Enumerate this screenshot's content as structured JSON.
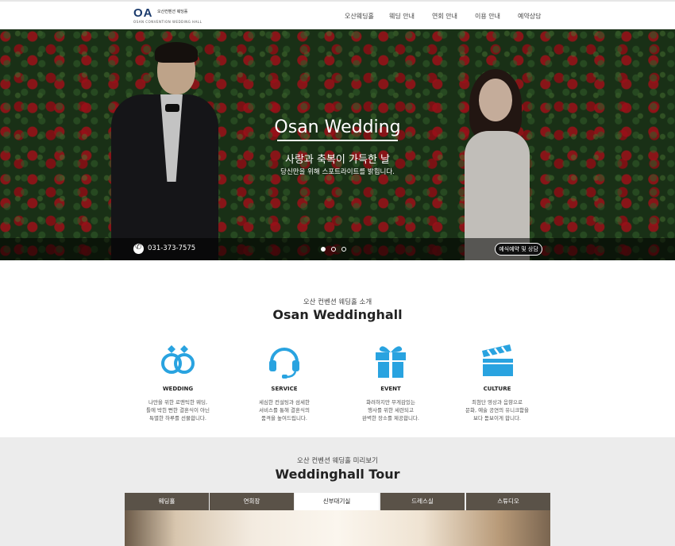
{
  "header": {
    "logo_mark": "OA",
    "logo_ko": "오산컨벤션 웨딩홀",
    "logo_en": "OSAN CONVENTION WEDDING HALL",
    "nav": [
      "오산웨딩홀",
      "웨딩 안내",
      "연회 안내",
      "이용 안내",
      "예약상담"
    ]
  },
  "hero": {
    "title": "Osan Wedding",
    "subtitle": "사랑과 축복이 가득한 날",
    "subtitle2": "당신만을 위해 스포트라이트를 밝힙니다.",
    "phone": "031-373-7575",
    "reserve_label": "예식예약 및 상담",
    "slide_count": 3,
    "active_slide": 1
  },
  "intro": {
    "subtitle": "오산 컨벤션 웨딩홀 소개",
    "title": "Osan Weddinghall",
    "accent_color": "#29a3e0",
    "features": [
      {
        "icon": "rings-icon",
        "name": "WEDDING",
        "desc": "나만을 위한 로맨틱한 웨딩,\n틀에 박힌 뻔한 결혼식이 아닌\n특별한 하루를 선물합니다."
      },
      {
        "icon": "headset-icon",
        "name": "SERVICE",
        "desc": "세심한 컨설팅과 섬세한\n서비스를 통해 결혼식의\n품격을 높여드립니다."
      },
      {
        "icon": "gift-icon",
        "name": "EVENT",
        "desc": "화려하지만 무게감있는\n행사를 위한 세련되고\n완벽한 장소를 제공합니다."
      },
      {
        "icon": "clapperboard-icon",
        "name": "CULTURE",
        "desc": "최첨단 영상과 음향으로\n문화, 예술 공연의 유니크함을\n보다 돋보이게 합니다."
      }
    ]
  },
  "tour": {
    "subtitle": "오산 컨벤션 웨딩홀 미리보기",
    "title": "Weddinghall Tour",
    "tabs": [
      "웨딩홀",
      "연회장",
      "신부대기실",
      "드레스실",
      "스튜디오"
    ],
    "active_tab": 2
  }
}
